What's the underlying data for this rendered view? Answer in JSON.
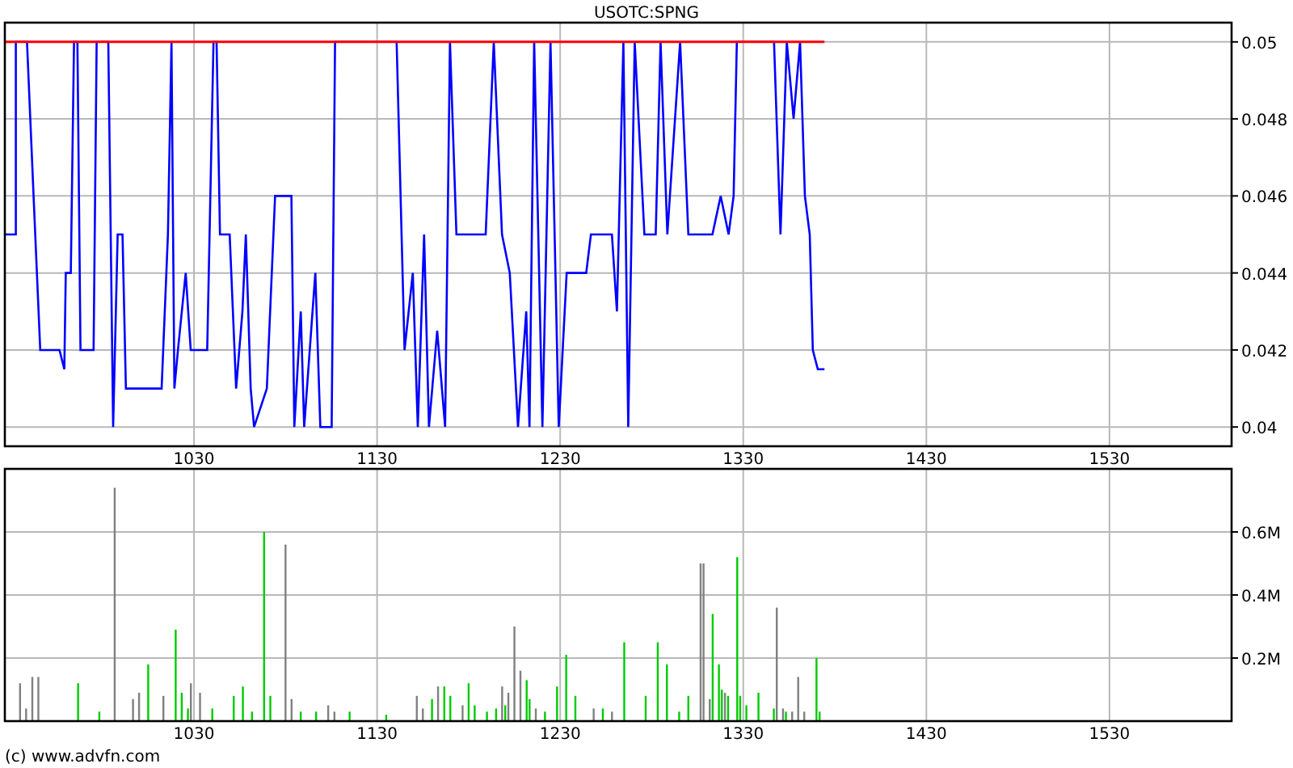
{
  "title": "USOTC:SPNG",
  "price_chart": {
    "chart_data": {
      "type": "line",
      "xlim": [
        926.7,
        1596.7
      ],
      "ylim": [
        0.0395,
        0.0505
      ],
      "grid": true,
      "xticks": [
        1030,
        1130,
        1230,
        1330,
        1430,
        1530
      ],
      "yticks": [
        {
          "value": 0.04,
          "label": "0.04"
        },
        {
          "value": 0.042,
          "label": "0.042"
        },
        {
          "value": 0.044,
          "label": "0.044"
        },
        {
          "value": 0.046,
          "label": "0.046"
        },
        {
          "value": 0.048,
          "label": "0.048"
        },
        {
          "value": 0.05,
          "label": "0.05"
        }
      ],
      "x": [
        926.7,
        932.7,
        932.7,
        938.8,
        943.3,
        946,
        956.5,
        959.2,
        960,
        962.7,
        964.5,
        966.3,
        968,
        975.2,
        976.8,
        983.2,
        985.8,
        988.3,
        991,
        992.8,
        1007.8,
        1012.3,
        1015.8,
        1017.7,
        1019.3,
        1021.2,
        1025.5,
        1028.2,
        1037.2,
        1040.7,
        1042.3,
        1044.2,
        1049.5,
        1053,
        1056.5,
        1058.3,
        1061,
        1062.8,
        1069.8,
        1074.3,
        1083.2,
        1084.8,
        1088.3,
        1090.2,
        1096.3,
        1099,
        1105.2,
        1107,
        1140.7,
        1145,
        1149.5,
        1152.2,
        1155.7,
        1158.3,
        1162.8,
        1167.2,
        1169.8,
        1173.3,
        1189.3,
        1193.7,
        1198.2,
        1202.5,
        1207,
        1211.5,
        1213.2,
        1215.8,
        1220.3,
        1224.7,
        1229.2,
        1233.5,
        1244.2,
        1246.8,
        1258.3,
        1261,
        1264.5,
        1267.2,
        1270.7,
        1276,
        1282.2,
        1284.8,
        1288.5,
        1295.5,
        1300,
        1313.2,
        1317.7,
        1322,
        1324.7,
        1326.5,
        1346.8,
        1350.3,
        1353.8,
        1357.5,
        1361,
        1363.7,
        1366.3,
        1368,
        1370.7,
        1374.3
      ],
      "series": [
        {
          "color": "#0000ff",
          "values": [
            0.045,
            0.045,
            0.05,
            0.05,
            0.045,
            0.042,
            0.042,
            0.0415,
            0.044,
            0.044,
            0.05,
            0.05,
            0.042,
            0.042,
            0.05,
            0.05,
            0.04,
            0.045,
            0.045,
            0.041,
            0.041,
            0.041,
            0.045,
            0.05,
            0.041,
            0.042,
            0.044,
            0.042,
            0.042,
            0.05,
            0.05,
            0.045,
            0.045,
            0.041,
            0.043,
            0.045,
            0.041,
            0.04,
            0.041,
            0.046,
            0.046,
            0.04,
            0.043,
            0.04,
            0.044,
            0.04,
            0.04,
            0.05,
            0.05,
            0.042,
            0.044,
            0.04,
            0.045,
            0.04,
            0.0425,
            0.04,
            0.05,
            0.045,
            0.045,
            0.05,
            0.045,
            0.044,
            0.04,
            0.043,
            0.04,
            0.05,
            0.04,
            0.05,
            0.04,
            0.044,
            0.044,
            0.045,
            0.045,
            0.043,
            0.05,
            0.04,
            0.05,
            0.045,
            0.045,
            0.05,
            0.045,
            0.05,
            0.045,
            0.045,
            0.046,
            0.045,
            0.046,
            0.05,
            0.05,
            0.045,
            0.05,
            0.048,
            0.05,
            0.046,
            0.045,
            0.042,
            0.0415,
            0.0415
          ]
        },
        {
          "color": "#ff0000",
          "values": [
            0.05,
            0.05,
            0.05,
            0.05,
            0.05,
            0.05,
            0.05,
            0.05,
            0.05,
            0.05,
            0.05,
            0.05,
            0.05,
            0.05,
            0.05,
            0.05,
            0.05,
            0.05,
            0.05,
            0.05,
            0.05,
            0.05,
            0.05,
            0.05,
            0.05,
            0.05,
            0.05,
            0.05,
            0.05,
            0.05,
            0.05,
            0.05,
            0.05,
            0.05,
            0.05,
            0.05,
            0.05,
            0.05,
            0.05,
            0.05,
            0.05,
            0.05,
            0.05,
            0.05,
            0.05,
            0.05,
            0.05,
            0.05,
            0.05,
            0.05,
            0.05,
            0.05,
            0.05,
            0.05,
            0.05,
            0.05,
            0.05,
            0.05,
            0.05,
            0.05,
            0.05,
            0.05,
            0.05,
            0.05,
            0.05,
            0.05,
            0.05,
            0.05,
            0.05,
            0.05,
            0.05,
            0.05,
            0.05,
            0.05,
            0.05,
            0.05,
            0.05,
            0.05,
            0.05,
            0.05,
            0.05,
            0.05,
            0.05,
            0.05,
            0.05,
            0.05,
            0.05,
            0.05,
            0.05,
            0.05,
            0.05,
            0.05,
            0.05,
            0.05,
            0.05,
            0.05,
            0.05,
            0.05
          ]
        }
      ]
    }
  },
  "volume_chart": {
    "chart_data": {
      "type": "bar",
      "xlim": [
        926.7,
        1596.7
      ],
      "ylim": [
        0,
        0.8
      ],
      "grid": true,
      "xticks": [
        1030,
        1130,
        1230,
        1330,
        1430,
        1530
      ],
      "yticks": [
        {
          "value": 0.2,
          "label": "0.2M"
        },
        {
          "value": 0.4,
          "label": "0.4M"
        },
        {
          "value": 0.6,
          "label": "0.6M"
        }
      ],
      "x": [
        935,
        938.3,
        941.7,
        945,
        966.7,
        978.3,
        986.7,
        996.7,
        1000,
        1005,
        1013.3,
        1020,
        1023.3,
        1026.7,
        1028.3,
        1033.3,
        1040,
        1051.7,
        1056.7,
        1061.7,
        1068.3,
        1071.7,
        1080,
        1083.3,
        1088.3,
        1096.7,
        1103.3,
        1106.7,
        1115,
        1135,
        1151.7,
        1155,
        1160,
        1163.3,
        1166.7,
        1170,
        1176.7,
        1180,
        1183.3,
        1190,
        1195,
        1198.3,
        1200,
        1201.7,
        1205,
        1208.3,
        1211.7,
        1213.3,
        1216.7,
        1221.7,
        1228.3,
        1233.3,
        1238.3,
        1248.3,
        1253.3,
        1258.3,
        1265,
        1276.7,
        1283.3,
        1288.3,
        1295,
        1300,
        1306.7,
        1308.3,
        1311.7,
        1313.3,
        1316.7,
        1318.3,
        1320,
        1321.7,
        1326.7,
        1328.3,
        1331.7,
        1338.3,
        1346.7,
        1348.3,
        1351.7,
        1353.3,
        1356.7,
        1360,
        1363.3,
        1370,
        1371.7
      ],
      "series": [
        {
          "color": "#00cc00",
          "values": [
            null,
            null,
            null,
            null,
            0.12,
            0.03,
            null,
            null,
            null,
            0.18,
            null,
            0.29,
            0.09,
            0.04,
            null,
            null,
            0.04,
            0.08,
            0.11,
            0.03,
            0.6,
            0.08,
            null,
            null,
            0.03,
            0.03,
            null,
            null,
            0.03,
            0.02,
            null,
            null,
            0.07,
            null,
            0.11,
            0.08,
            null,
            0.12,
            0.05,
            0.03,
            0.04,
            null,
            0.05,
            null,
            null,
            null,
            0.13,
            0.07,
            null,
            0.03,
            0.11,
            0.21,
            0.08,
            null,
            0.04,
            null,
            0.25,
            0.08,
            0.25,
            0.18,
            0.03,
            0.08,
            null,
            null,
            null,
            0.34,
            0.18,
            0.1,
            null,
            0.08,
            0.52,
            0.08,
            0.05,
            0.09,
            0.04,
            null,
            null,
            0.03,
            null,
            null,
            null,
            0.2,
            0.03
          ]
        },
        {
          "color": "#808080",
          "values": [
            0.12,
            0.04,
            0.14,
            0.14,
            null,
            null,
            0.74,
            0.07,
            0.09,
            null,
            0.08,
            null,
            null,
            null,
            0.12,
            0.09,
            null,
            null,
            null,
            null,
            null,
            null,
            0.56,
            0.07,
            null,
            null,
            0.05,
            0.03,
            null,
            null,
            0.08,
            0.04,
            null,
            0.11,
            null,
            null,
            0.05,
            null,
            null,
            null,
            null,
            0.11,
            null,
            0.09,
            0.3,
            0.16,
            null,
            null,
            0.04,
            null,
            null,
            null,
            null,
            0.04,
            null,
            0.03,
            null,
            null,
            null,
            null,
            null,
            null,
            0.5,
            0.5,
            0.07,
            null,
            null,
            null,
            0.09,
            null,
            null,
            null,
            null,
            null,
            null,
            0.36,
            0.04,
            null,
            0.03,
            0.14,
            0.03,
            null,
            null
          ]
        }
      ]
    }
  },
  "footer": "(c) www.advfn.com"
}
